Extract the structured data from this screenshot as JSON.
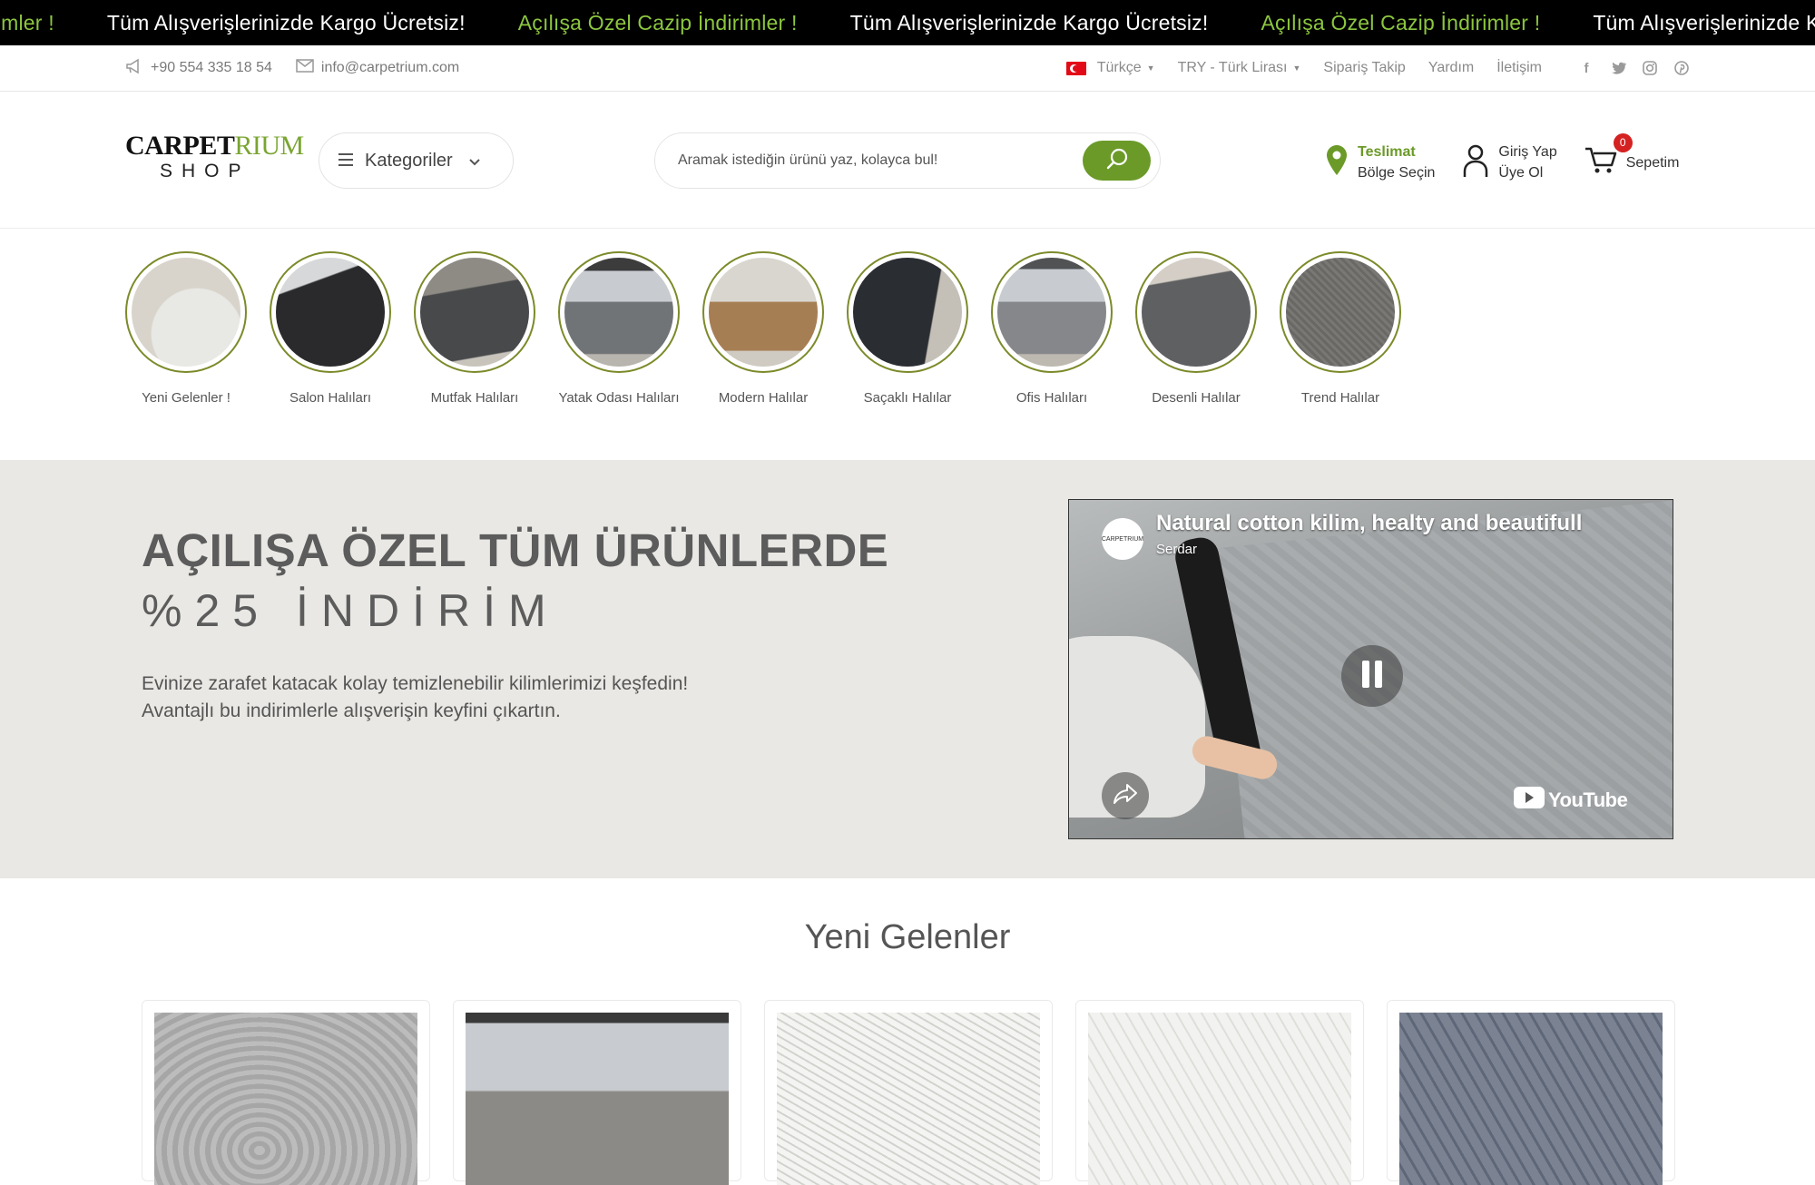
{
  "marquee": {
    "items": [
      {
        "text": "Açılışa Özel Cazip İndirimler !",
        "style": "green"
      },
      {
        "text": "Tüm Alışverişlerinizde Kargo Ücretsiz!",
        "style": "white"
      },
      {
        "text": "Açılışa Özel Cazip İndirimler !",
        "style": "green"
      },
      {
        "text": "Tüm Alışverişlerinizde Kargo Ücretsiz!",
        "style": "white"
      },
      {
        "text": "Açılışa Özel Cazip İndirimler !",
        "style": "green"
      },
      {
        "text": "Tüm Alışverişlerinizde Kargo Ücretsiz!",
        "style": "white"
      }
    ]
  },
  "topbar": {
    "phone": "+90 554 335 18 54",
    "email": "info@carpetrium.com",
    "language": "Türkçe",
    "currency": "TRY - Türk Lirası",
    "order_tracking": "Sipariş Takip",
    "help": "Yardım",
    "contact": "İletişim",
    "social_icons": [
      "facebook-icon",
      "twitter-icon",
      "instagram-icon",
      "pinterest-icon"
    ]
  },
  "header": {
    "logo_main": "CARPET",
    "logo_accent": "RIUM",
    "logo_sub": "SHOP",
    "categories_label": "Kategoriler",
    "search_placeholder": "Aramak istediğin ürünü yaz, kolayca bul!",
    "delivery_title": "Teslimat",
    "delivery_sub": "Bölge Seçin",
    "login": "Giriş Yap",
    "register": "Üye Ol",
    "cart_label": "Sepetim",
    "cart_count": "0",
    "accent_color": "#6b9a28"
  },
  "categories": [
    {
      "label": "Yeni Gelenler !"
    },
    {
      "label": "Salon Halıları"
    },
    {
      "label": "Mutfak Halıları"
    },
    {
      "label": "Yatak Odası Halıları"
    },
    {
      "label": "Modern Halılar"
    },
    {
      "label": "Saçaklı Halılar"
    },
    {
      "label": "Ofis Halıları"
    },
    {
      "label": "Desenli Halılar"
    },
    {
      "label": "Trend Halılar"
    }
  ],
  "hero": {
    "headline": "AÇILIŞA ÖZEL TÜM ÜRÜNLERDE",
    "subheadline": "%25 İNDİRİM",
    "text_line1": "Evinize zarafet katacak kolay temizlenebilir kilimlerimizi keşfedin!",
    "text_line2": "Avantajlı bu indirimlerle alışverişin keyfini çıkartın.",
    "video": {
      "title": "Natural cotton kilim, healty and beautifull",
      "channel": "Serdar",
      "avatar_text": "CARPETRIUM",
      "platform": "YouTube"
    }
  },
  "new_arrivals": {
    "title": "Yeni Gelenler",
    "product_count": 5
  }
}
